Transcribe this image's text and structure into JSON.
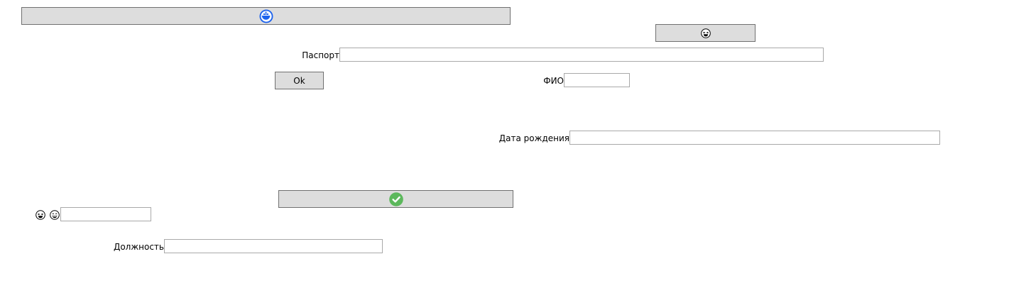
{
  "buttons": {
    "top_icon": "docker-icon",
    "emoji_icon": "laughing-face-icon",
    "ok_label": "Ok",
    "check_icon": "check-circle-icon"
  },
  "labels": {
    "passport": "Паспорт",
    "fio": "ФИО",
    "birth_date": "Дата рождения",
    "position": "Должность"
  },
  "fields": {
    "passport": "",
    "fio": "",
    "birth_date": "",
    "emoji_field": "",
    "position": ""
  },
  "inline_icons": [
    "laughing-face-icon",
    "grinning-face-icon"
  ],
  "colors": {
    "docker_blue": "#1d63ed",
    "check_green": "#5cb85c",
    "button_bg": "#dddddd",
    "button_border": "#707070"
  }
}
